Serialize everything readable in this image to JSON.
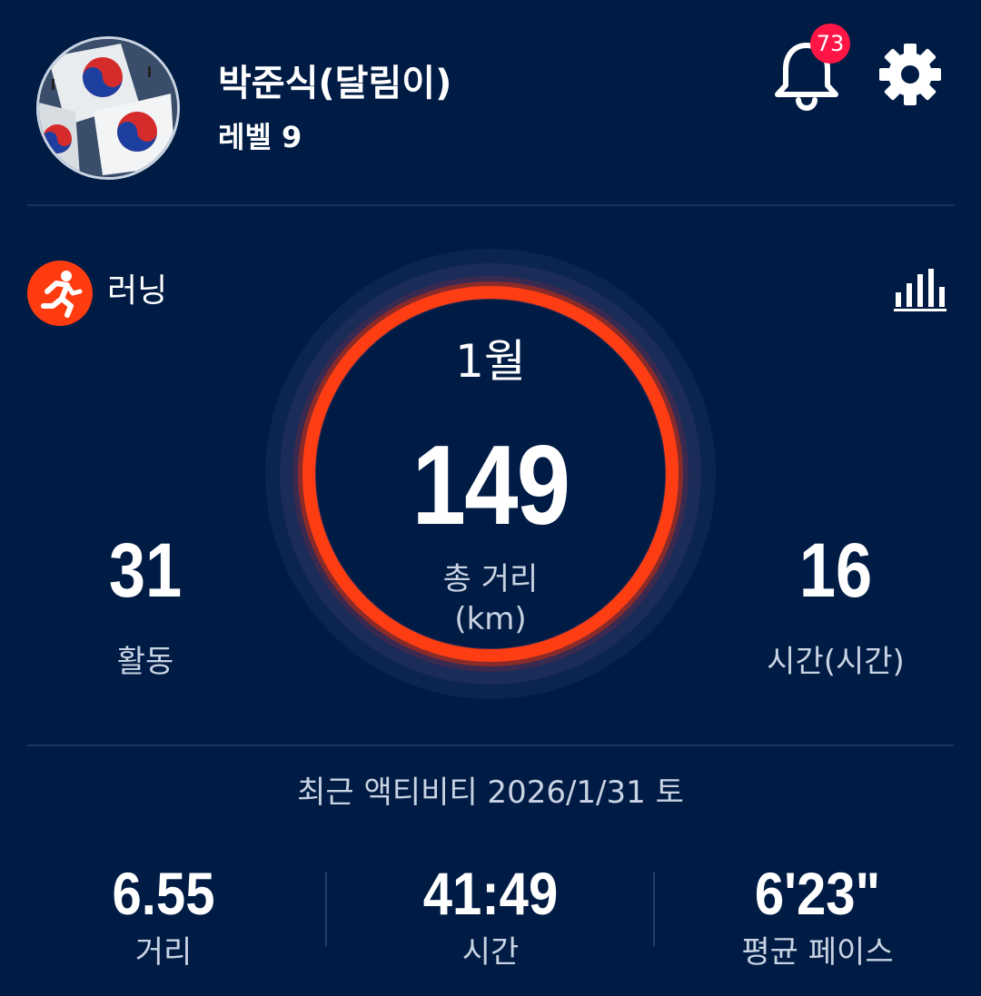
{
  "profile": {
    "avatar_icon": "korean-flag-photo",
    "name": "박준식(달림이)",
    "level": "레벨 9"
  },
  "header": {
    "notification_icon": "bell-icon",
    "notification_count": "73",
    "settings_icon": "gear-icon"
  },
  "activity_type": {
    "icon": "running-person-icon",
    "label": "러닝",
    "stats_icon": "bar-chart-icon"
  },
  "summary": {
    "month": "1월",
    "total_distance": "149",
    "total_distance_label": "총 거리",
    "total_distance_unit": "(km)",
    "activities_value": "31",
    "activities_label": "활동",
    "hours_value": "16",
    "hours_label": "시간(시간)"
  },
  "recent": {
    "title": "최근 액티비티 2026/1/31 토",
    "distance_value": "6.55",
    "distance_label": "거리",
    "time_value": "41:49",
    "time_label": "시간",
    "pace_value": "6'23\"",
    "pace_label": "평균 페이스"
  },
  "colors": {
    "background": "#001c44",
    "ring_accent": "#ff3d12",
    "badge": "#ff1646",
    "muted_text": "#c9d3e4"
  }
}
